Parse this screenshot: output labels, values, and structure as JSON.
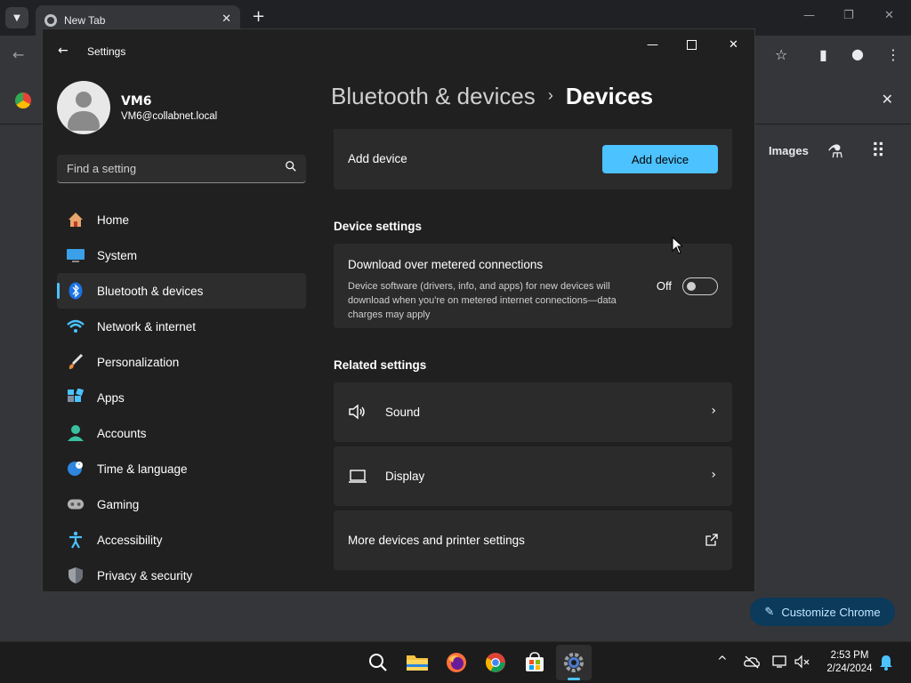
{
  "browser": {
    "tab_title": "New Tab",
    "new_tab_symbol": "+",
    "images_link": "Images",
    "customize_label": "Customize Chrome"
  },
  "settings": {
    "app_title": "Settings",
    "profile": {
      "name": "VM6",
      "email": "VM6@collabnet.local"
    },
    "search": {
      "placeholder": "Find a setting"
    },
    "nav": [
      {
        "label": "Home",
        "icon": "home-icon"
      },
      {
        "label": "System",
        "icon": "system-icon"
      },
      {
        "label": "Bluetooth & devices",
        "icon": "bluetooth-icon",
        "active": true
      },
      {
        "label": "Network & internet",
        "icon": "wifi-icon"
      },
      {
        "label": "Personalization",
        "icon": "brush-icon"
      },
      {
        "label": "Apps",
        "icon": "apps-icon"
      },
      {
        "label": "Accounts",
        "icon": "account-icon"
      },
      {
        "label": "Time & language",
        "icon": "globe-clock-icon"
      },
      {
        "label": "Gaming",
        "icon": "gamepad-icon"
      },
      {
        "label": "Accessibility",
        "icon": "accessibility-icon"
      },
      {
        "label": "Privacy & security",
        "icon": "shield-icon"
      }
    ],
    "breadcrumb": {
      "parent": "Bluetooth & devices",
      "separator": "›",
      "current": "Devices"
    },
    "add_device": {
      "label": "Add device",
      "button": "Add device"
    },
    "device_settings": {
      "title": "Device settings",
      "metered": {
        "title": "Download over metered connections",
        "description": "Device software (drivers, info, and apps) for new devices will download when you're on metered internet connections—data charges may apply",
        "state": "Off"
      }
    },
    "related": {
      "title": "Related settings",
      "items": [
        {
          "label": "Sound",
          "icon": "speaker-icon"
        },
        {
          "label": "Display",
          "icon": "laptop-icon"
        },
        {
          "label": "More devices and printer settings",
          "icon": "external-link-icon"
        }
      ]
    }
  },
  "taskbar": {
    "time": "2:53 PM",
    "date": "2/24/2024"
  },
  "colors": {
    "accent": "#4cc2ff",
    "window_bg": "#202020",
    "card_bg": "#2b2b2b"
  }
}
